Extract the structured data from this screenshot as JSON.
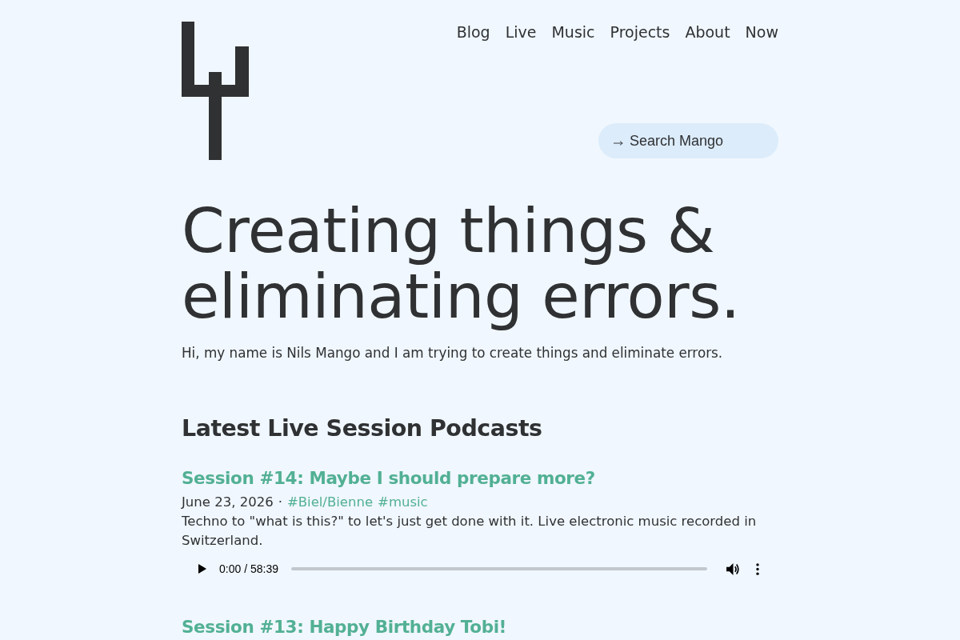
{
  "header": {
    "nav": [
      "Blog",
      "Live",
      "Music",
      "Projects",
      "About",
      "Now"
    ],
    "search": {
      "placeholder": "Search Mango"
    }
  },
  "hero": {
    "title": "Creating things & eliminating errors.",
    "intro": "Hi, my name is Nils Mango and I am trying to create things and eliminate errors."
  },
  "podcasts": {
    "heading": "Latest Live Session Podcasts",
    "episodes": [
      {
        "title": "Session #14: Maybe I should prepare more?",
        "date": "June 23, 2026",
        "separator": "·",
        "tags": [
          "#Biel/Bienne",
          "#music"
        ],
        "description": "Techno to \"what is this?\" to let's just get done with it. Live electronic music recorded in Switzerland.",
        "player": {
          "time": "0:00 / 58:39",
          "level": 0
        }
      },
      {
        "title": "Session #13: Happy Birthday Tobi!"
      }
    ]
  }
}
